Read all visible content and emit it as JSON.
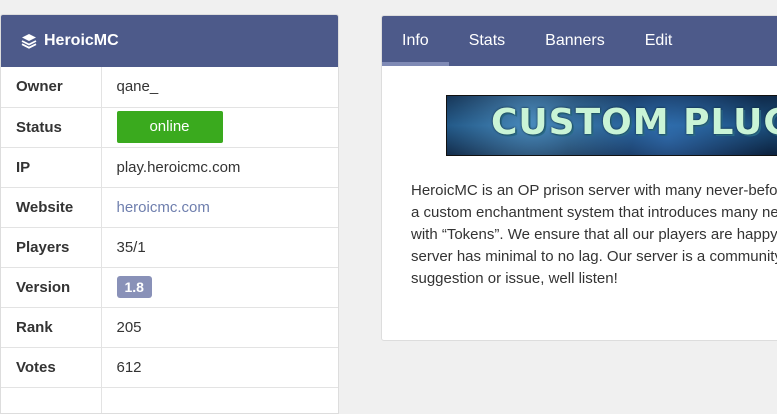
{
  "server_panel": {
    "title": "HeroicMC",
    "rows": {
      "owner": {
        "key": "Owner",
        "value": "qane_"
      },
      "status": {
        "key": "Status",
        "value": "online"
      },
      "ip": {
        "key": "IP",
        "value": "play.heroicmc.com"
      },
      "website": {
        "key": "Website",
        "value": "heroicmc.com"
      },
      "players": {
        "key": "Players",
        "value": "35/1"
      },
      "version": {
        "key": "Version",
        "value": "1.8"
      },
      "rank": {
        "key": "Rank",
        "value": "205"
      },
      "votes": {
        "key": "Votes",
        "value": "612"
      }
    }
  },
  "detail_panel": {
    "tabs": [
      "Info",
      "Stats",
      "Banners",
      "Edit"
    ],
    "active_tab": "Info",
    "banner_text": "CUSTOM PLUG",
    "description": "HeroicMC is an OP prison server with many never-befor\na custom enchantment system that introduces many ne\nwith “Tokens”. We ensure that all our players are happy\nserver has minimal to no lag. Our server is a community\nsuggestion or issue, well listen!"
  },
  "colors": {
    "header": "#4d5a8a",
    "status_green": "#3aaa1e",
    "version_badge": "#8991b8",
    "link": "#6f7fae"
  }
}
